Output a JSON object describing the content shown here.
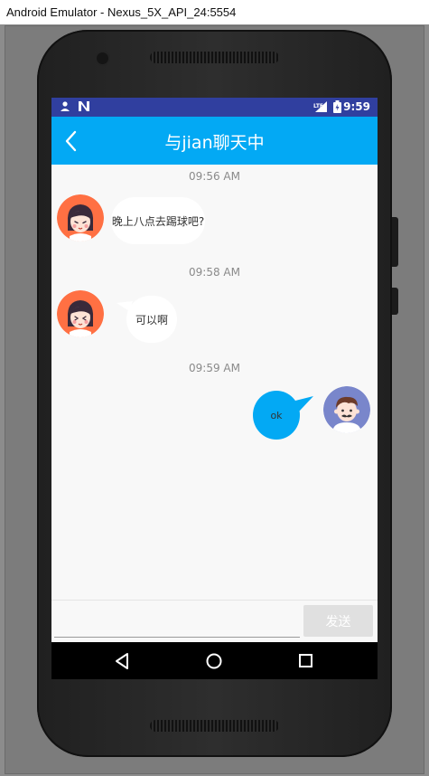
{
  "window": {
    "title": "Android Emulator - Nexus_5X_API_24:5554"
  },
  "statusbar": {
    "time": "9:59",
    "left_icons": [
      "person-icon",
      "nfc-icon"
    ],
    "right_icons": [
      "lte-signal-icon",
      "battery-icon"
    ]
  },
  "appbar": {
    "title": "与jian聊天中",
    "back_icon": "back-chevron-icon",
    "color": "#03a9f4"
  },
  "messages": [
    {
      "time": "09:56 AM",
      "direction": "in",
      "text": "晚上八点去踢球吧?",
      "avatar": "girl-avatar"
    },
    {
      "time": "09:58 AM",
      "direction": "in",
      "text": "可以啊",
      "avatar": "girl-avatar"
    },
    {
      "time": "09:59 AM",
      "direction": "out",
      "text": "ok",
      "avatar": "man-avatar"
    }
  ],
  "input": {
    "value": "",
    "placeholder": ""
  },
  "send_button": {
    "label": "发送"
  },
  "navbar": {
    "buttons": [
      "back-triangle-icon",
      "home-circle-icon",
      "recents-square-icon"
    ]
  },
  "colors": {
    "statusbar": "#303f9f",
    "accent": "#03a9f4",
    "girl_avatar_bg": "#ff7043",
    "man_avatar_bg": "#7986cb"
  }
}
